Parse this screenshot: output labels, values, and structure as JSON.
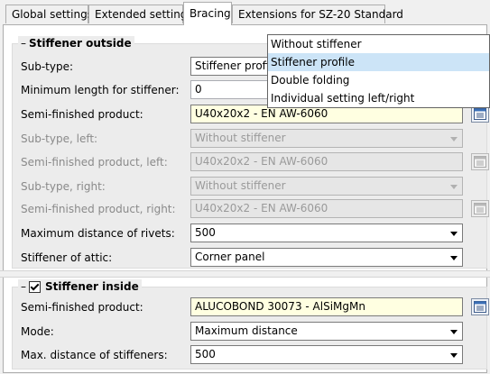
{
  "tabs": [
    {
      "label": "Global settings"
    },
    {
      "label": "Extended settings"
    },
    {
      "label": "Bracing"
    },
    {
      "label": "Extensions for SZ-20 Standard"
    }
  ],
  "stiffener_outside": {
    "title": "Stiffener outside",
    "subtype": {
      "label": "Sub-type:",
      "value": "Stiffener profile"
    },
    "min_length": {
      "label": "Minimum length for stiffener:",
      "value": "0"
    },
    "semi_finished": {
      "label": "Semi-finished product:",
      "value": "U40x20x2 - EN AW-6060"
    },
    "subtype_left": {
      "label": "Sub-type, left:",
      "value": "Without stiffener"
    },
    "semi_finished_left": {
      "label": "Semi-finished product, left:",
      "value": "U40x20x2 - EN AW-6060"
    },
    "subtype_right": {
      "label": "Sub-type, right:",
      "value": "Without stiffener"
    },
    "semi_finished_right": {
      "label": "Semi-finished product, right:",
      "value": "U40x20x2 - EN AW-6060"
    },
    "max_rivets": {
      "label": "Maximum distance of rivets:",
      "value": "500"
    },
    "attic": {
      "label": "Stiffener of attic:",
      "value": "Corner panel"
    }
  },
  "stiffener_inside": {
    "title": "Stiffener inside",
    "checked": true,
    "semi_finished": {
      "label": "Semi-finished product:",
      "value": "ALUCOBOND 30073 - AlSiMgMn"
    },
    "mode": {
      "label": "Mode:",
      "value": "Maximum distance"
    },
    "max_stiffeners": {
      "label": "Max. distance of stiffeners:",
      "value": "500"
    }
  },
  "dropdown": {
    "options": [
      "Without stiffener",
      "Stiffener profile",
      "Double folding",
      "Individual setting left/right"
    ],
    "selected_index": 1
  }
}
